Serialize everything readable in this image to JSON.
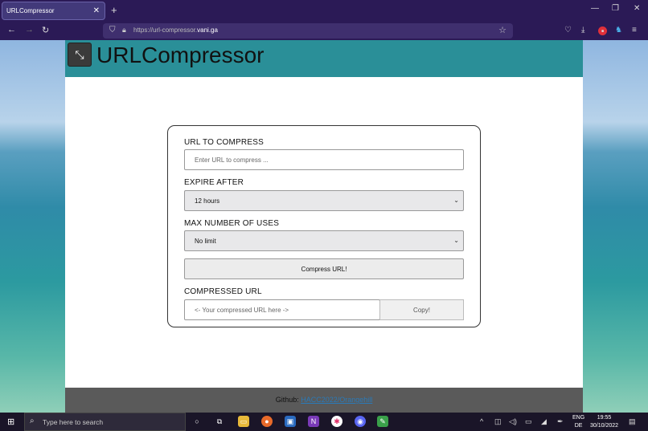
{
  "browser": {
    "tab_title": "URLCompressor",
    "tab_close": "✕",
    "new_tab": "+",
    "url_prefix": "https://url-compressor.",
    "url_domain": "vani.ga",
    "window_controls": [
      "—",
      "❐",
      "✕"
    ]
  },
  "site": {
    "title": "URLCompressor",
    "logo_icon": "compress-arrows-icon",
    "form": {
      "url_label": "URL TO COMPRESS",
      "url_placeholder": "Enter URL to compress ...",
      "expire_label": "EXPIRE AFTER",
      "expire_selected": "12 hours",
      "uses_label": "MAX NUMBER OF USES",
      "uses_selected": "No limit",
      "compress_button": "Compress URL!",
      "compressed_label": "COMPRESSED URL",
      "compressed_placeholder": "<- Your compressed URL here ->",
      "copy_button": "Copy!"
    },
    "footer": {
      "prefix": "Github: ",
      "link_text": "HACC2022/Orangehill"
    }
  },
  "taskbar": {
    "search_placeholder": "Type here to search",
    "lang_top": "ENG",
    "lang_bottom": "DE",
    "time": "19:55",
    "date": "30/10/2022"
  },
  "colors": {
    "header": "#2a8f98",
    "footer": "#5a5a5a",
    "browser_chrome": "#2b1a56",
    "link": "#2a7ab8"
  }
}
